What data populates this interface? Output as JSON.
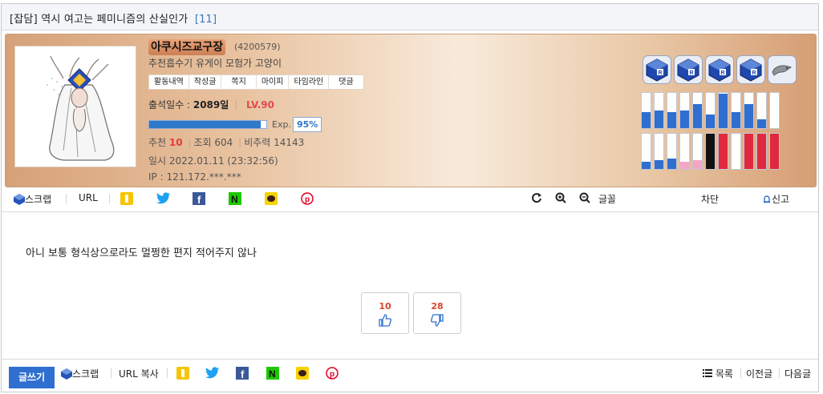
{
  "post": {
    "category": "[잡담]",
    "title": "역시 여고는 페미니즘의 산실인가",
    "comment_count": "[11]",
    "body": "아니 보통 형식상으로라도 멀쩡한 편지 적어주지 않나"
  },
  "author": {
    "nickname": "아쿠시즈교구장",
    "id": "(4200579)",
    "intro": "추천흡수기 유게이 모험가 고양이",
    "menu": [
      "활동내역",
      "작성글",
      "쪽지",
      "마이피",
      "타임라인",
      "댓글"
    ],
    "attendance_label": "출석일수 :",
    "attendance_value": "2089일",
    "level": "LV.90",
    "exp_label": "Exp.",
    "exp_percent": "95%",
    "exp_fraction": 0.95,
    "recommend_label": "추천",
    "recommend_value": "10",
    "views": "조회 604",
    "nonrec": "비추력 14143",
    "datetime": "일시 2022.01.11 (23:32:56)",
    "ip": "IP : 121.172.***.***"
  },
  "badges": [
    "blue-cube-icon",
    "blue-cube-icon",
    "blue-cube-icon",
    "blue-cube-icon",
    "dolphin-icon"
  ],
  "gauges_top": [
    {
      "color": "#2f6fd0",
      "level": 0.45
    },
    {
      "color": "#2f6fd0",
      "level": 0.5
    },
    {
      "color": "#2f6fd0",
      "level": 0.45
    },
    {
      "color": "#2f6fd0",
      "level": 0.5
    },
    {
      "color": "#2f6fd0",
      "level": 0.68
    },
    {
      "color": "#2f6fd0",
      "level": 0.38
    },
    {
      "color": "#2f6fd0",
      "level": 0.98
    },
    {
      "color": "#2f6fd0",
      "level": 0.45
    },
    {
      "color": "#2f6fd0",
      "level": 0.68
    },
    {
      "color": "#2f6fd0",
      "level": 0.25
    },
    {
      "color": "#2f6fd0",
      "level": 0.0
    }
  ],
  "gauges_bottom": [
    {
      "color": "#2f6fd0",
      "level": 0.2
    },
    {
      "color": "#2f6fd0",
      "level": 0.25
    },
    {
      "color": "#2f6fd0",
      "level": 0.3
    },
    {
      "color": "#f4a6c8",
      "level": 0.2
    },
    {
      "color": "#f4a6c8",
      "level": 0.25
    },
    {
      "color": "#111111",
      "level": 1.0
    },
    {
      "color": "#e0283e",
      "level": 1.0
    },
    {
      "color": "#e0283e",
      "level": 0.0
    },
    {
      "color": "#e0283e",
      "level": 1.0
    },
    {
      "color": "#e0283e",
      "level": 1.0
    },
    {
      "color": "#e0283e",
      "level": 1.0
    }
  ],
  "share": {
    "scrap": "스크랩",
    "url": "URL",
    "tools": [
      "refresh-icon",
      "zoom-in-icon",
      "zoom-out-icon"
    ],
    "font": "글꼴",
    "block": "차단",
    "report": "신고"
  },
  "votes": {
    "up": "10",
    "down": "28"
  },
  "footer": {
    "write": "글쓰기",
    "scrap": "스크랩",
    "url_copy": "URL 복사",
    "list": "목록",
    "prev": "이전글",
    "next": "다음글"
  },
  "colors": {
    "accent": "#2f6fd0",
    "level": "#e24a4a",
    "profile_bg": "#e9c4a2"
  }
}
